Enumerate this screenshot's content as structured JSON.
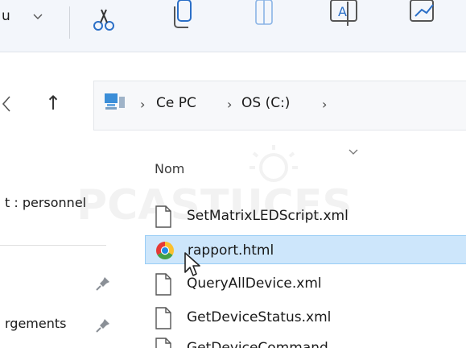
{
  "toolbar": {
    "view_partial_label": "u",
    "tools": [
      "scissors-icon",
      "copy-icon",
      "paste-icon",
      "rename-icon",
      "share-icon"
    ]
  },
  "navigation": {
    "up_arrow": "↑",
    "back_chevron": "‹"
  },
  "address_bar": {
    "breadcrumbs": [
      "Ce PC",
      "OS (C:)"
    ],
    "separator": "›"
  },
  "nav_pane": {
    "items": [
      {
        "label": "t : personnel",
        "pinned": false
      },
      {
        "label": "",
        "pinned": true
      },
      {
        "label": "rgements",
        "pinned": true
      }
    ]
  },
  "file_list": {
    "column_header": "Nom",
    "files": [
      {
        "name": "SetMatrixLEDScript.xml",
        "icon": "document-icon",
        "selected": false
      },
      {
        "name": "rapport.html",
        "icon": "chrome-icon",
        "selected": true
      },
      {
        "name": "QueryAllDevice.xml",
        "icon": "document-icon",
        "selected": false
      },
      {
        "name": "GetDeviceStatus.xml",
        "icon": "document-icon",
        "selected": false
      },
      {
        "name": "GetDeviceCommand...",
        "icon": "document-icon",
        "selected": false
      }
    ]
  },
  "watermark": {
    "text": "PCASTUCES"
  },
  "colors": {
    "selection_bg": "#cde6fb",
    "selection_border": "#99cdf5",
    "toolbar_bg": "#f3f6fb"
  }
}
